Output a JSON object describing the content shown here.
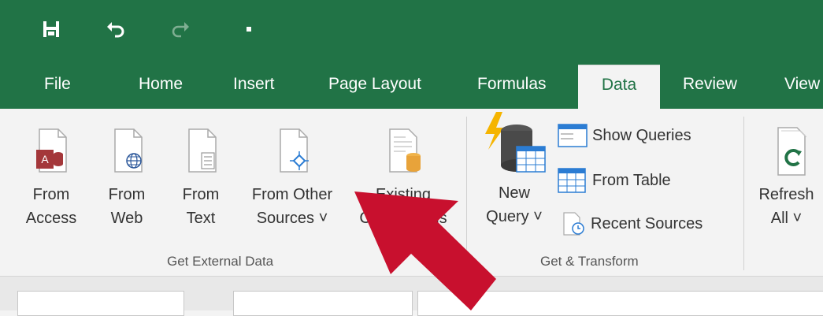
{
  "qat": {
    "items": [
      {
        "name": "save-icon"
      },
      {
        "name": "undo-icon"
      },
      {
        "name": "redo-icon"
      },
      {
        "name": "customize-qat-icon"
      }
    ]
  },
  "tabs": [
    {
      "label": "File"
    },
    {
      "label": "Home"
    },
    {
      "label": "Insert"
    },
    {
      "label": "Page Layout"
    },
    {
      "label": "Formulas"
    },
    {
      "label": "Data",
      "active": true
    },
    {
      "label": "Review"
    },
    {
      "label": "View"
    }
  ],
  "ribbon": {
    "get_external_data": {
      "label": "Get External Data",
      "buttons": [
        {
          "line1": "From",
          "line2": "Access"
        },
        {
          "line1": "From",
          "line2": "Web"
        },
        {
          "line1": "From",
          "line2": "Text"
        },
        {
          "line1": "From Other",
          "line2": "Sources ˅"
        },
        {
          "line1": "Existing",
          "line2": "Connections"
        }
      ]
    },
    "get_transform": {
      "label": "Get & Transform",
      "new_query": {
        "line1": "New",
        "line2": "Query ˅"
      },
      "show_queries": "Show Queries",
      "from_table": "From Table",
      "recent_sources": "Recent Sources"
    },
    "connections": {
      "refresh_all": {
        "line1": "Refresh",
        "line2": "All ˅"
      }
    }
  },
  "colors": {
    "accent": "#217346",
    "arrow": "#c8102e"
  }
}
